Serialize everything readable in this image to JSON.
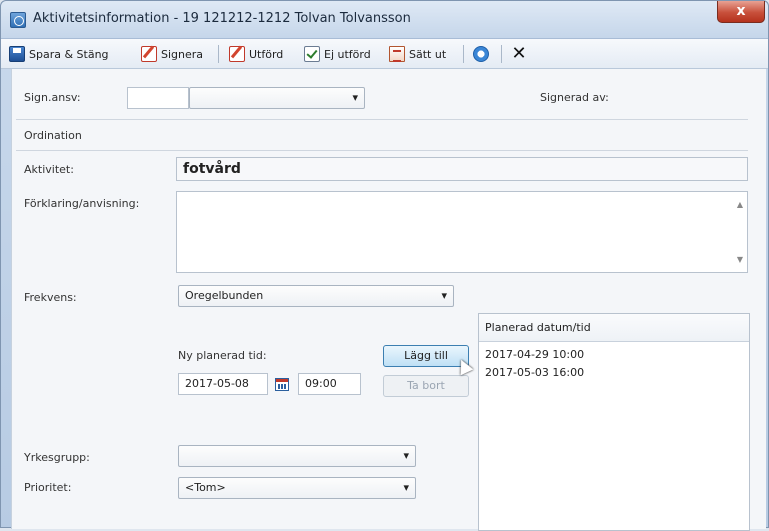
{
  "window": {
    "title": "Aktivitetsinformation - 19 121212-1212 Tolvan Tolvansson",
    "close_label": "x"
  },
  "toolbar": {
    "save_close": "Spara & Stäng",
    "sign": "Signera",
    "done": "Utförd",
    "not_done": "Ej utförd",
    "set_out": "Sätt ut"
  },
  "form": {
    "sign_resp_label": "Sign.ansv:",
    "signed_by_label": "Signerad av:",
    "ordination_label": "Ordination",
    "activity_label": "Aktivitet:",
    "activity_value": "fotvård",
    "explanation_label": "Förklaring/anvisning:",
    "frequency_label": "Frekvens:",
    "frequency_value": "Oregelbunden",
    "new_time_label": "Ny planerad tid:",
    "date_value": "2017-05-08",
    "time_value": "09:00",
    "add_button": "Lägg till",
    "remove_button": "Ta bort",
    "profession_label": "Yrkesgrupp:",
    "profession_value": "",
    "priority_label": "Prioritet:",
    "priority_value": "<Tom>"
  },
  "planned_list": {
    "header": "Planerad datum/tid",
    "items": [
      "2017-04-29 10:00",
      "2017-05-03 16:00"
    ]
  }
}
